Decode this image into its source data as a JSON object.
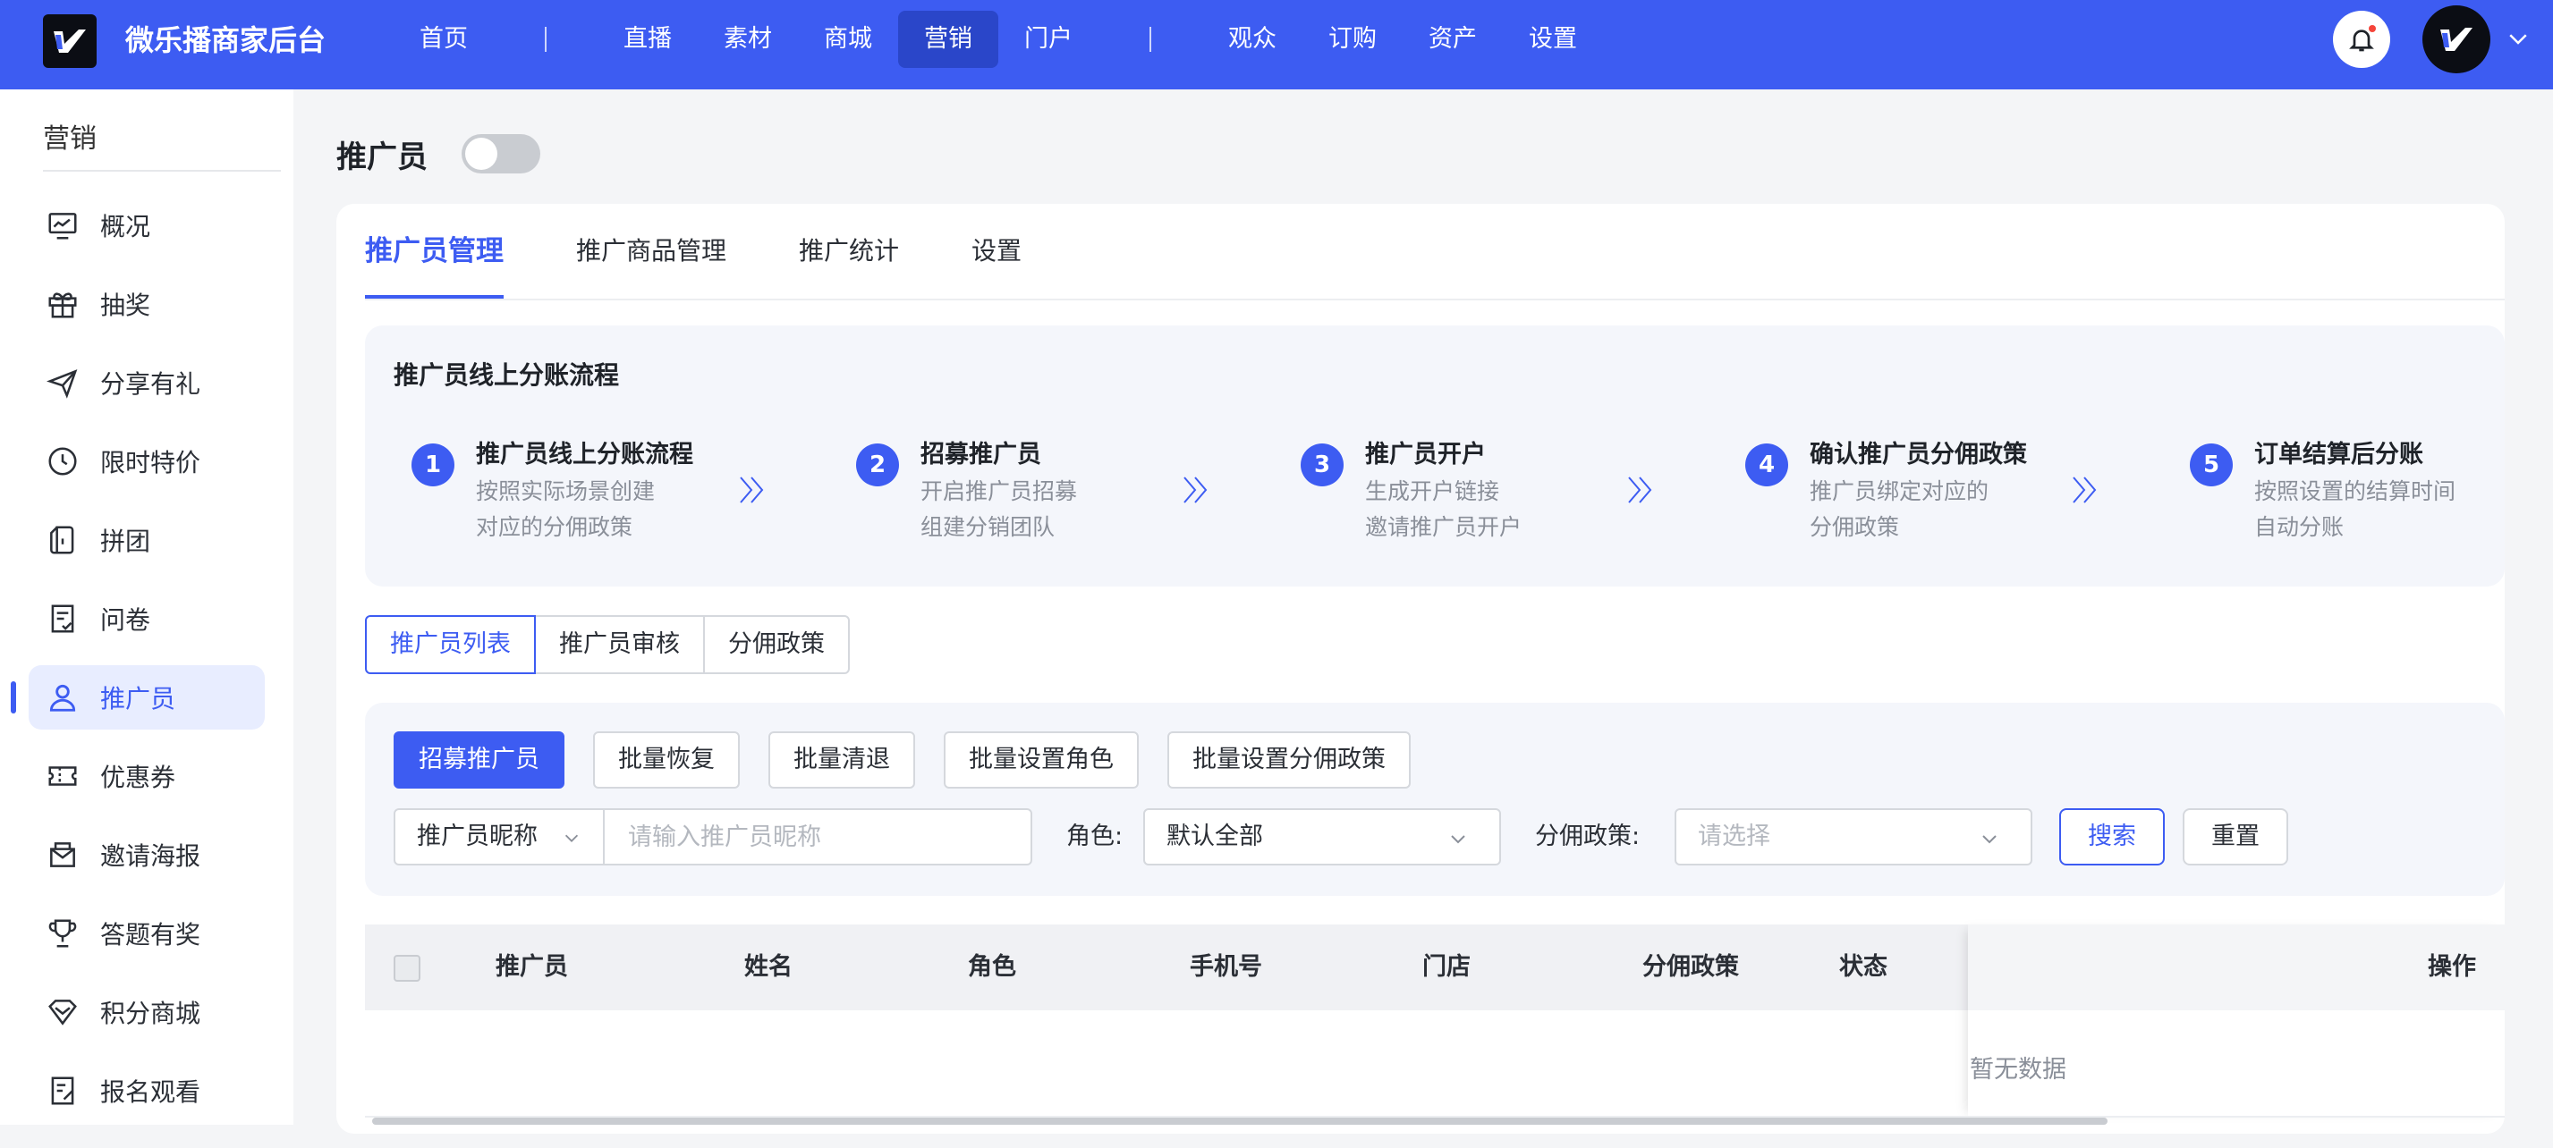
{
  "app": {
    "brand": "微乐播商家后台"
  },
  "nav": {
    "items": [
      {
        "label": "首页",
        "active": false
      },
      {
        "label": "直播",
        "active": false
      },
      {
        "label": "素材",
        "active": false
      },
      {
        "label": "商城",
        "active": false
      },
      {
        "label": "营销",
        "active": true
      },
      {
        "label": "门户",
        "active": false
      },
      {
        "label": "观众",
        "active": false
      },
      {
        "label": "订购",
        "active": false
      },
      {
        "label": "资产",
        "active": false
      },
      {
        "label": "设置",
        "active": false
      }
    ]
  },
  "sidebar": {
    "title": "营销",
    "items": [
      {
        "label": "概况",
        "icon": "chart-icon"
      },
      {
        "label": "抽奖",
        "icon": "gift-icon"
      },
      {
        "label": "分享有礼",
        "icon": "paper-plane-icon"
      },
      {
        "label": "限时特价",
        "icon": "clock-icon"
      },
      {
        "label": "拼团",
        "icon": "group-buy-icon"
      },
      {
        "label": "问卷",
        "icon": "survey-icon"
      },
      {
        "label": "推广员",
        "icon": "user-icon",
        "active": true
      },
      {
        "label": "优惠券",
        "icon": "coupon-icon"
      },
      {
        "label": "邀请海报",
        "icon": "poster-icon"
      },
      {
        "label": "答题有奖",
        "icon": "trophy-icon"
      },
      {
        "label": "积分商城",
        "icon": "diamond-icon"
      },
      {
        "label": "报名观看",
        "icon": "signup-icon"
      }
    ]
  },
  "page": {
    "title": "推广员",
    "toggle_on": false
  },
  "tabs": [
    {
      "label": "推广员管理",
      "active": true
    },
    {
      "label": "推广商品管理",
      "active": false
    },
    {
      "label": "推广统计",
      "active": false
    },
    {
      "label": "设置",
      "active": false
    }
  ],
  "flow": {
    "title": "推广员线上分账流程",
    "steps": [
      {
        "num": "1",
        "title": "推广员线上分账流程",
        "desc1": "按照实际场景创建",
        "desc2": "对应的分佣政策"
      },
      {
        "num": "2",
        "title": "招募推广员",
        "desc1": "开启推广员招募",
        "desc2": "组建分销团队"
      },
      {
        "num": "3",
        "title": "推广员开户",
        "desc1": "生成开户链接",
        "desc2": "邀请推广员开户"
      },
      {
        "num": "4",
        "title": "确认推广员分佣政策",
        "desc1": "推广员绑定对应的",
        "desc2": "分佣政策"
      },
      {
        "num": "5",
        "title": "订单结算后分账",
        "desc1": "按照设置的结算时间",
        "desc2": "自动分账"
      }
    ]
  },
  "segments": [
    {
      "label": "推广员列表",
      "active": true
    },
    {
      "label": "推广员审核",
      "active": false
    },
    {
      "label": "分佣政策",
      "active": false
    }
  ],
  "actions": {
    "recruit": "招募推广员",
    "batch_restore": "批量恢复",
    "batch_clear": "批量清退",
    "batch_role": "批量设置角色",
    "batch_policy": "批量设置分佣政策"
  },
  "filters": {
    "type_select": "推广员昵称",
    "name_placeholder": "请输入推广员昵称",
    "role_label": "角色:",
    "role_value": "默认全部",
    "policy_label": "分佣政策:",
    "policy_placeholder": "请选择",
    "search": "搜索",
    "reset": "重置"
  },
  "table": {
    "columns": [
      "推广员",
      "姓名",
      "角色",
      "手机号",
      "门店",
      "分佣政策",
      "状态",
      "操作"
    ],
    "empty": "暂无数据"
  },
  "colors": {
    "primary": "#3d5cf2",
    "nav_active": "#2a46c9"
  }
}
